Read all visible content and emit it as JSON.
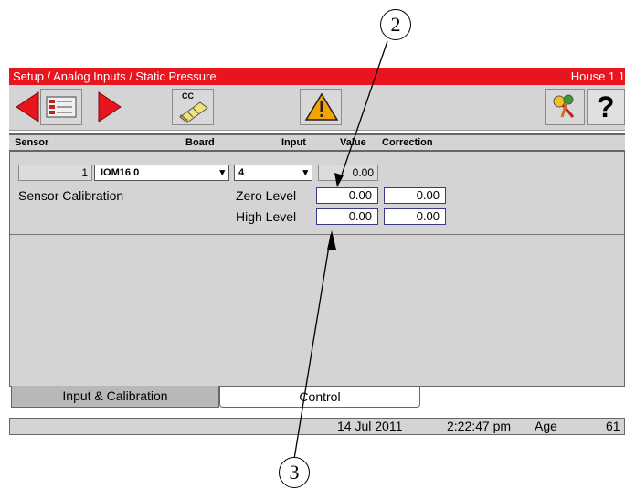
{
  "title_bar": {
    "path": "Setup / Analog Inputs / Static Pressure",
    "house": "House 1 1"
  },
  "toolbar": {
    "prev_icon": "left-arrow-icon",
    "list_icon": "list-icon",
    "next_icon": "right-arrow-icon",
    "cc_label": "CC",
    "cc_icon": "cc-tool-icon",
    "warning_icon": "warning-icon",
    "key_icon": "key-icon",
    "help_label": "?",
    "help_icon": "help-icon"
  },
  "table_header": {
    "sensor": "Sensor",
    "board": "Board",
    "input": "Input",
    "value": "Value",
    "correction": "Correction"
  },
  "sensor_row": {
    "sensor_number": "1",
    "board": "IOM16 0",
    "input": "4",
    "value": "0.00"
  },
  "calibration": {
    "label": "Sensor Calibration",
    "zero_label": "Zero Level",
    "zero_value": "0.00",
    "zero_correction": "0.00",
    "high_label": "High Level",
    "high_value": "0.00",
    "high_correction": "0.00"
  },
  "tabs": [
    {
      "label": "Input & Calibration",
      "active": true
    },
    {
      "label": "Control",
      "active": false
    }
  ],
  "status_bar": {
    "date": "14 Jul 2011",
    "time": "2:22:47 pm",
    "age_label": "Age",
    "age_value": "61"
  },
  "callouts": {
    "top": "2",
    "bottom": "3"
  },
  "colors": {
    "title_bar": "#e8141e",
    "panel": "#d4d4d4",
    "arrow": "#e8141e",
    "warning": "#f5a300",
    "value_border": "#3a3a8a"
  }
}
